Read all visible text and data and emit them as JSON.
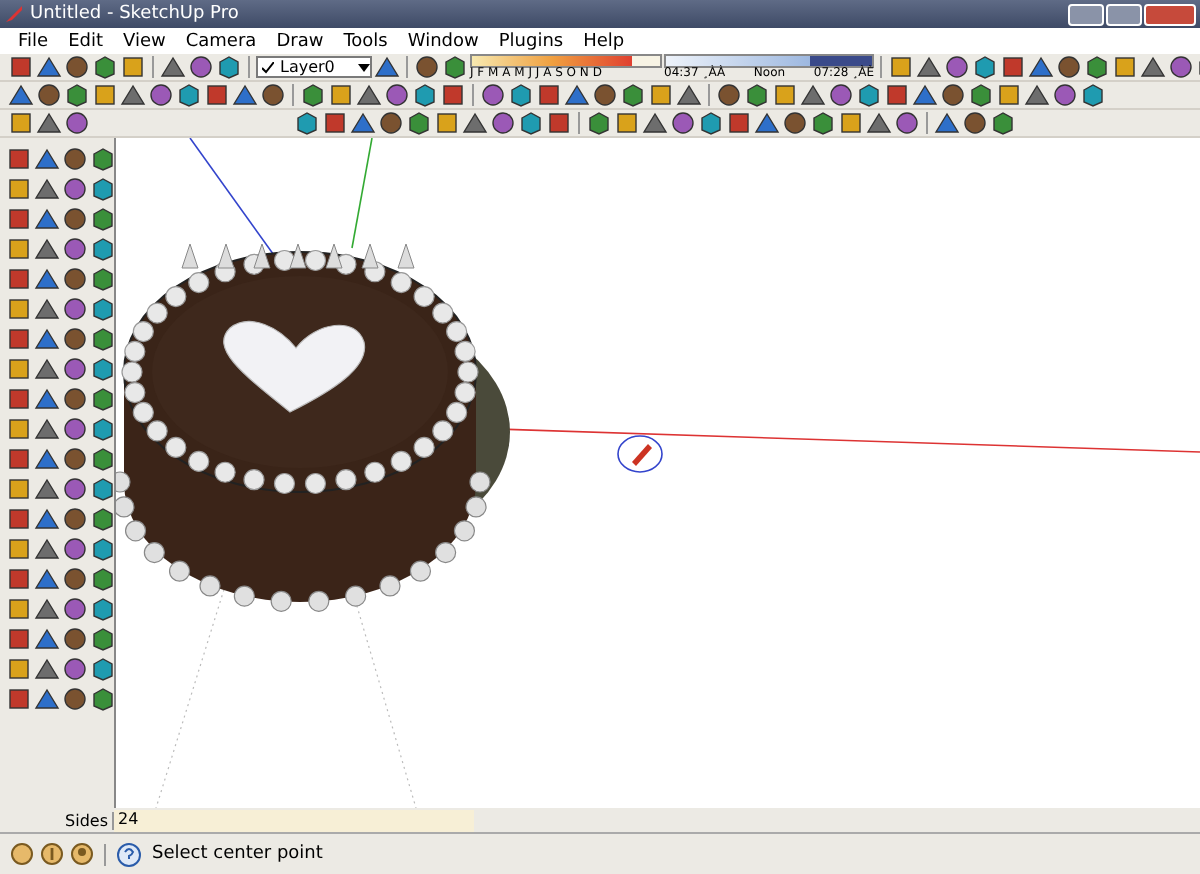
{
  "window": {
    "title": "Untitled - SketchUp Pro"
  },
  "menu": [
    "File",
    "Edit",
    "View",
    "Camera",
    "Draw",
    "Tools",
    "Window",
    "Plugins",
    "Help"
  ],
  "layer_dropdown": {
    "value": "Layer0"
  },
  "shadow_settings": {
    "date_slider": {
      "level": 0.85
    },
    "time_slider": {
      "level": 0.7
    },
    "months": "J F M A M J J A S O N D",
    "sunrise": "04:37 ¸ÀÀ",
    "noon": "Noon",
    "sunset": "07:28 ¸ÀÈ"
  },
  "measurements": {
    "label": "Sides",
    "value": "24"
  },
  "status_bar": {
    "text": "Select center point"
  }
}
